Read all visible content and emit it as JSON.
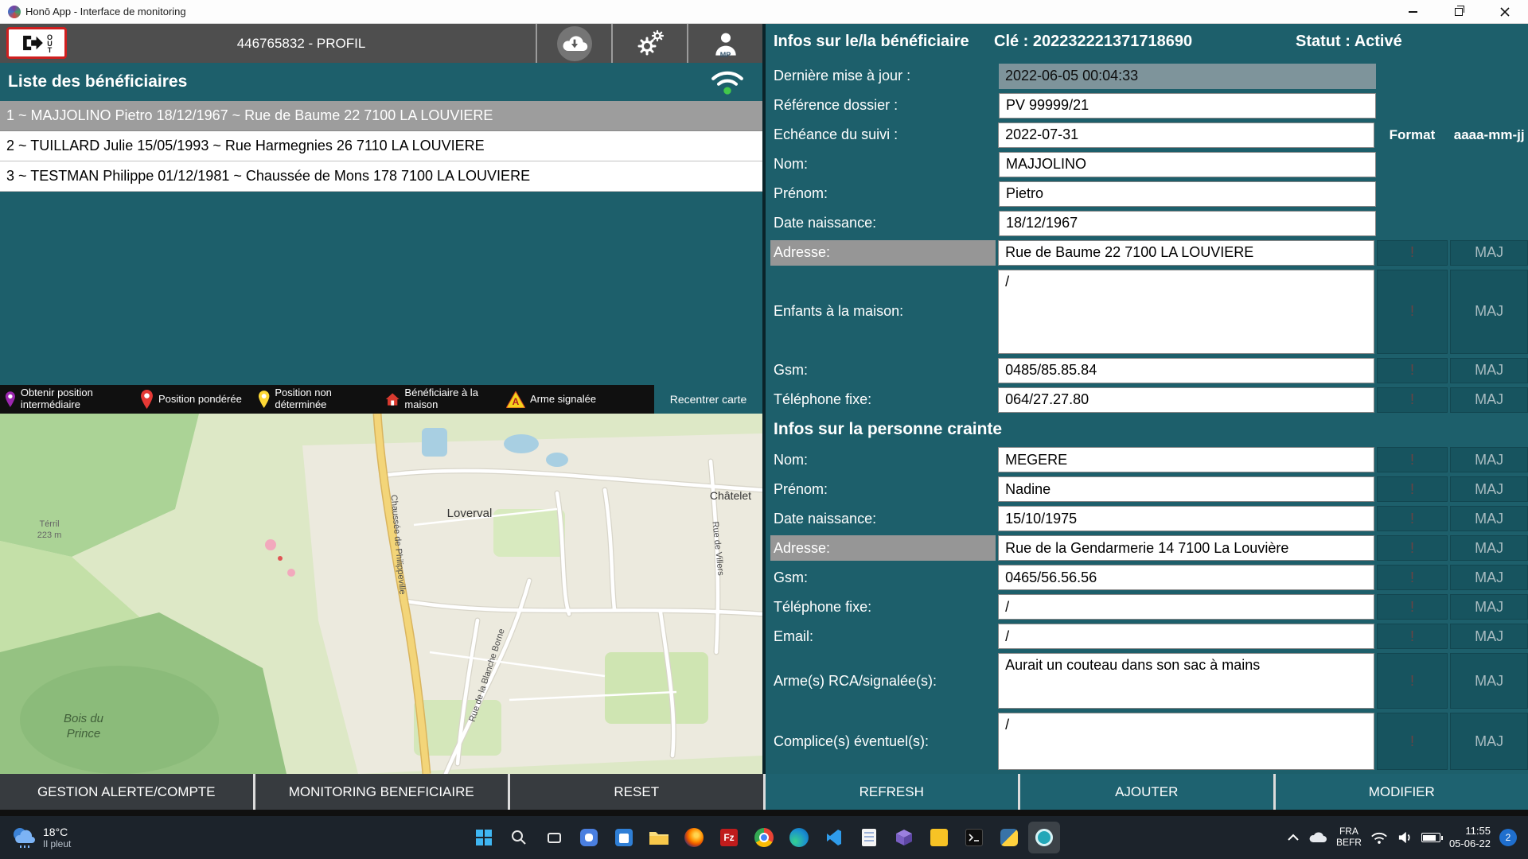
{
  "titlebar": {
    "title": "Honō App - Interface de monitoring"
  },
  "toolbar": {
    "profile": "446765832 - PROFIL",
    "logout_text": "OUT",
    "mp_text": "MP"
  },
  "list": {
    "header": "Liste des bénéficiaires",
    "items": [
      "1 ~ MAJJOLINO Pietro 18/12/1967 ~ Rue de Baume 22 7100 LA LOUVIERE",
      "2 ~ TUILLARD Julie 15/05/1993 ~ Rue Harmegnies 26 7110 LA LOUVIERE",
      "3 ~ TESTMAN Philippe 01/12/1981 ~ Chaussée de Mons 178 7100 LA LOUVIERE"
    ]
  },
  "legend": {
    "items": [
      "Obtenir position intermédiaire",
      "Position pondérée",
      "Position non déterminée",
      "Bénéficiaire à la maison",
      "Arme signalée"
    ],
    "arme_letter": "A",
    "recenter": "Recentrer carte"
  },
  "map": {
    "labels": {
      "loverval": "Loverval",
      "chatelet": "Châtelet",
      "terril": "Térril",
      "terril_alt": "223 m",
      "bois1": "Bois du",
      "bois2": "Prince",
      "philippeville": "Chaussée de Philippeville",
      "blanche": "Rue de la Blanche Borne",
      "villers": "Rue de Villers"
    }
  },
  "beneficiary": {
    "title": "Infos sur le/la bénéficiaire",
    "key": "Clé : 202232221371718690",
    "status": "Statut : Activé",
    "format_label": "Format",
    "format_value": "aaaa-mm-jj",
    "last_update": {
      "label": "Dernière mise à jour :",
      "value": "2022-06-05 00:04:33"
    },
    "reference": {
      "label": "Référence dossier :",
      "value": "PV 99999/21"
    },
    "echeance": {
      "label": "Echéance du suivi :",
      "value": "2022-07-31"
    },
    "nom": {
      "label": "Nom:",
      "value": "MAJJOLINO"
    },
    "prenom": {
      "label": "Prénom:",
      "value": "Pietro"
    },
    "naissance": {
      "label": "Date naissance:",
      "value": "18/12/1967"
    },
    "adresse": {
      "label": "Adresse:",
      "value": "Rue de Baume 22 7100 LA LOUVIERE"
    },
    "enfants": {
      "label": "Enfants à la maison:",
      "value": "/"
    },
    "gsm": {
      "label": "Gsm:",
      "value": "0485/85.85.84"
    },
    "fixe": {
      "label": "Téléphone fixe:",
      "value": "064/27.27.80"
    }
  },
  "feared": {
    "title": "Infos sur la personne crainte",
    "nom": {
      "label": "Nom:",
      "value": "MEGERE"
    },
    "prenom": {
      "label": "Prénom:",
      "value": "Nadine"
    },
    "naissance": {
      "label": "Date naissance:",
      "value": "15/10/1975"
    },
    "adresse": {
      "label": "Adresse:",
      "value": "Rue de la Gendarmerie 14 7100 La Louvière"
    },
    "gsm": {
      "label": "Gsm:",
      "value": "0465/56.56.56"
    },
    "fixe": {
      "label": "Téléphone fixe:",
      "value": "/"
    },
    "email": {
      "label": "Email:",
      "value": "/"
    },
    "armes": {
      "label": "Arme(s) RCA/signalée(s):",
      "value": "Aurait un couteau dans son sac à mains"
    },
    "complices": {
      "label": "Complice(s) éventuel(s):",
      "value": "/"
    }
  },
  "actions": {
    "warn": "!",
    "maj": "MAJ"
  },
  "bottom": {
    "gestion": "GESTION ALERTE/COMPTE",
    "monitoring": "MONITORING BENEFICIAIRE",
    "reset": "RESET",
    "refresh": "REFRESH",
    "ajouter": "AJOUTER",
    "modifier": "MODIFIER"
  },
  "taskbar": {
    "weather_temp": "18°C",
    "weather_desc": "Il pleut",
    "filezilla_label": "Fz",
    "lang_top": "FRA",
    "lang_bottom": "BEFR",
    "time": "11:55",
    "date": "05-06-22",
    "badge": "2"
  },
  "colors": {
    "panel_teal": "#1d5f6b",
    "toolbar_gray": "#4e4e4e",
    "selected_row": "#9d9d9d",
    "pin_intermediate": "#9c27b0",
    "pin_weighted": "#e53935",
    "pin_undetermined": "#fdd835",
    "home_marker": "#d93a2f",
    "weapon_warning": "#f6d21c",
    "logout_border": "#cf1f1f"
  }
}
